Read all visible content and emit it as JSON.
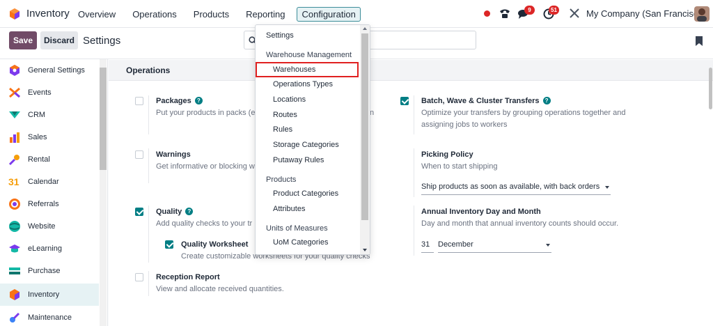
{
  "app": {
    "name": "Inventory"
  },
  "nav": {
    "items": [
      "Overview",
      "Operations",
      "Products",
      "Reporting",
      "Configuration"
    ],
    "messages_badge": "9",
    "activities_badge": "51",
    "company": "My Company (San Francisco)"
  },
  "controls": {
    "save_label": "Save",
    "discard_label": "Discard",
    "title": "Settings"
  },
  "sidebar": {
    "items": [
      {
        "label": "General Settings",
        "icon": "gear-icon"
      },
      {
        "label": "Events",
        "icon": "events-icon"
      },
      {
        "label": "CRM",
        "icon": "crm-icon"
      },
      {
        "label": "Sales",
        "icon": "sales-icon"
      },
      {
        "label": "Rental",
        "icon": "rental-icon"
      },
      {
        "label": "Calendar",
        "icon": "calendar-icon",
        "glyph": "31"
      },
      {
        "label": "Referrals",
        "icon": "referrals-icon"
      },
      {
        "label": "Website",
        "icon": "website-icon"
      },
      {
        "label": "eLearning",
        "icon": "elearning-icon"
      },
      {
        "label": "Purchase",
        "icon": "purchase-icon"
      },
      {
        "label": "Inventory",
        "icon": "inventory-icon"
      },
      {
        "label": "Maintenance",
        "icon": "maintenance-icon"
      }
    ],
    "active": "Inventory"
  },
  "section": {
    "title": "Operations",
    "settings": {
      "packages": {
        "title": "Packages",
        "desc": "Put your products in packs (e",
        "desc_tail": "n",
        "checked": false
      },
      "warnings": {
        "title": "Warnings",
        "desc": "Get informative or blocking w",
        "checked": false
      },
      "quality": {
        "title": "Quality",
        "desc": "Add quality checks to your tr",
        "checked": true
      },
      "quality_worksheet": {
        "title": "Quality Worksheet",
        "desc": "Create customizable worksheets for your quality checks",
        "checked": true
      },
      "reception_report": {
        "title": "Reception Report",
        "desc": "View and allocate received quantities.",
        "checked": false
      },
      "batch": {
        "title": "Batch, Wave & Cluster Transfers",
        "desc1": "Optimize your transfers by grouping operations together and",
        "desc2": "assigning jobs to workers",
        "checked": true
      },
      "picking_policy": {
        "title": "Picking Policy",
        "desc": "When to start shipping",
        "value": "Ship products as soon as available, with back orders"
      },
      "annual_inventory": {
        "title": "Annual Inventory Day and Month",
        "desc": "Day and month that annual inventory counts should occur.",
        "day": "31",
        "month": "December"
      }
    }
  },
  "dropdown": {
    "settings": "Settings",
    "groups": [
      {
        "header": "Warehouse Management",
        "items": [
          "Warehouses",
          "Operations Types",
          "Locations",
          "Routes",
          "Rules",
          "Storage Categories",
          "Putaway Rules"
        ]
      },
      {
        "header": "Products",
        "items": [
          "Product Categories",
          "Attributes"
        ]
      },
      {
        "header": "Units of Measures",
        "items": [
          "UoM Categories"
        ]
      }
    ],
    "highlighted": "Warehouses"
  },
  "colors": {
    "brand": "#714b67",
    "accent": "#017e84",
    "highlight": "#e02020",
    "active_bg": "#e6f2f4"
  }
}
